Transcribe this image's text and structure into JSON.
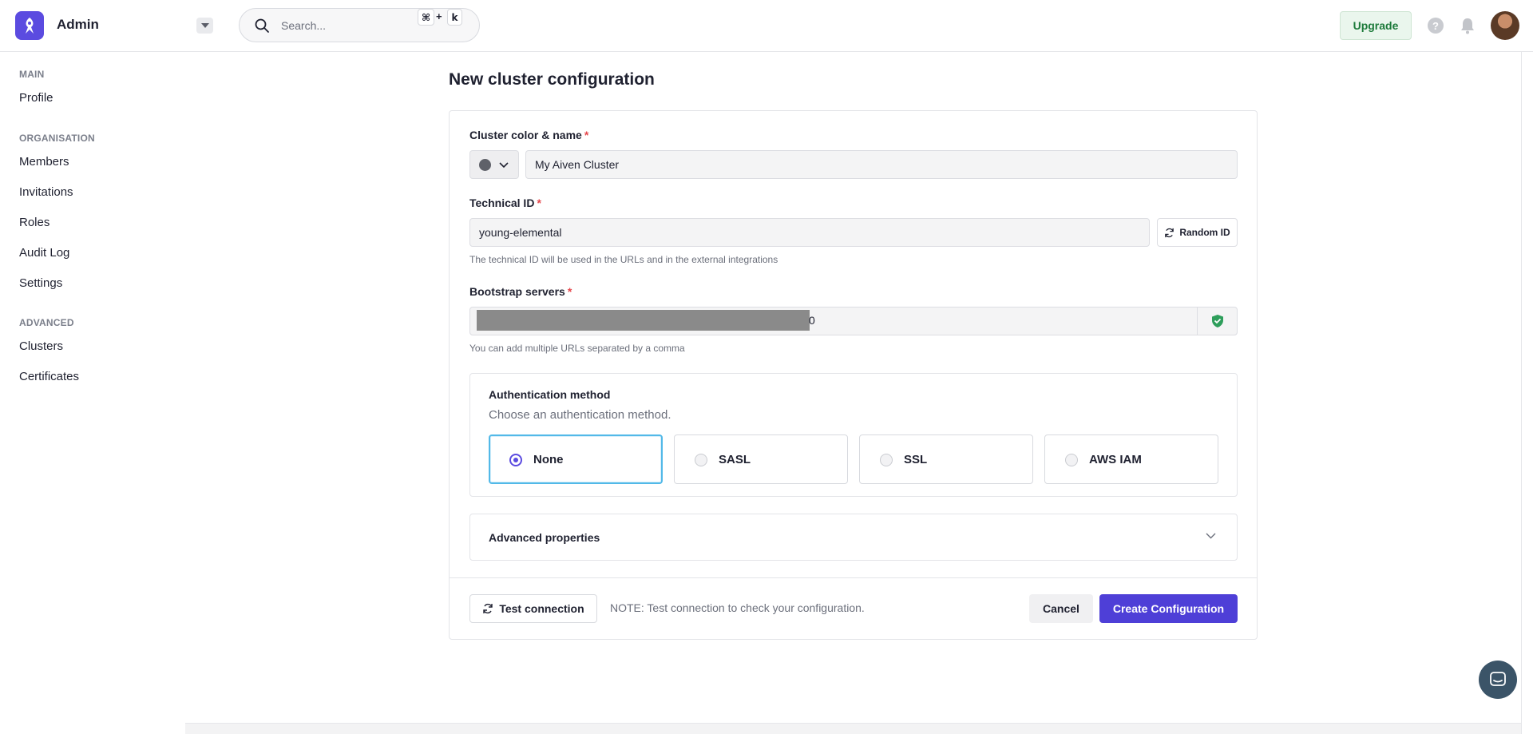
{
  "header": {
    "app_title": "Admin",
    "search_placeholder": "Search...",
    "shortcut_key1": "⌘",
    "shortcut_plus": "+",
    "shortcut_key2": "k",
    "upgrade_label": "Upgrade",
    "help_label": "?"
  },
  "sidebar": {
    "sections": [
      {
        "title": "MAIN",
        "items": [
          "Profile"
        ]
      },
      {
        "title": "ORGANISATION",
        "items": [
          "Members",
          "Invitations",
          "Roles",
          "Audit Log",
          "Settings"
        ]
      },
      {
        "title": "ADVANCED",
        "items": [
          "Clusters",
          "Certificates"
        ]
      }
    ]
  },
  "page": {
    "title": "New cluster configuration"
  },
  "form": {
    "name_label": "Cluster color & name",
    "required_mark": "*",
    "cluster_name": "My Aiven Cluster",
    "cluster_color": "#5f6169",
    "technical_id_label": "Technical ID",
    "technical_id": "young-elemental",
    "random_id_label": "Random ID",
    "technical_id_hint": "The technical ID will be used in the URLs and in the external integrations",
    "bootstrap_label": "Bootstrap servers",
    "bootstrap_visible_tail": "0",
    "bootstrap_hint": "You can add multiple URLs separated by a comma",
    "auth_title": "Authentication method",
    "auth_subtitle": "Choose an authentication method.",
    "auth_options": [
      "None",
      "SASL",
      "SSL",
      "AWS IAM"
    ],
    "auth_selected": "None",
    "advanced_label": "Advanced properties",
    "test_connection_label": "Test connection",
    "note": "NOTE: Test connection to check your configuration.",
    "cancel_label": "Cancel",
    "create_label": "Create Configuration"
  },
  "colors": {
    "brand": "#5b4be0",
    "primary_button": "#4e3fd7",
    "selected_border": "#52b9e8",
    "required": "#e5484d",
    "upgrade_bg": "#eaf6ed",
    "upgrade_text": "#1c7a3a",
    "verified": "#2e9e5b"
  }
}
